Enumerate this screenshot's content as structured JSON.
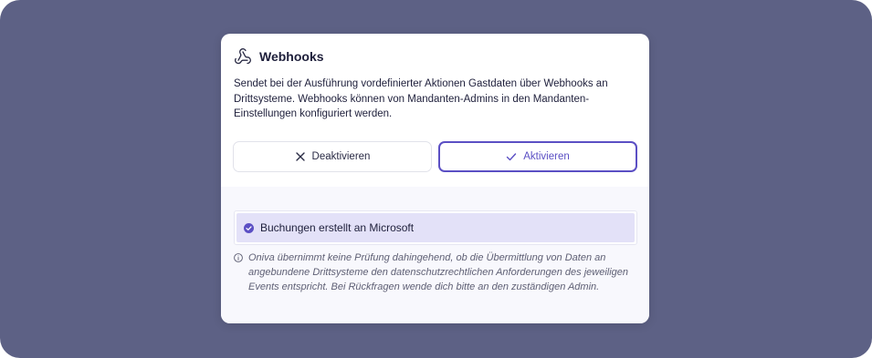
{
  "dialog": {
    "title": "Webhooks",
    "title_icon": "webhook-icon",
    "description": "Sendet bei der Ausführung vordefinierter Aktionen Gastdaten über Webhooks an Drittsysteme. Webhooks können von Mandanten-Admins in den Mandanten-Einstellungen konfiguriert werden.",
    "buttons": {
      "deactivate_label": "Deaktivieren",
      "deactivate_icon": "close-icon",
      "activate_label": "Aktivieren",
      "activate_icon": "check-icon"
    },
    "events": [
      {
        "label": "Buchungen erstellt an Microsoft",
        "checked": true,
        "icon": "check-circle-icon"
      }
    ],
    "notice": {
      "icon": "info-icon",
      "text": "Oniva übernimmt keine Prüfung dahingehend, ob die Übermittlung von Daten an angebundene Drittsysteme den datenschutzrechtlichen Anforderungen des jeweiligen Events entspricht. Bei Rückfragen wende dich bitte an den zuständigen Admin."
    }
  },
  "colors": {
    "backdrop": "#5d6185",
    "accent": "#5b4fc4",
    "selected_row": "#e3e1f8",
    "text": "#1e1f3b"
  }
}
